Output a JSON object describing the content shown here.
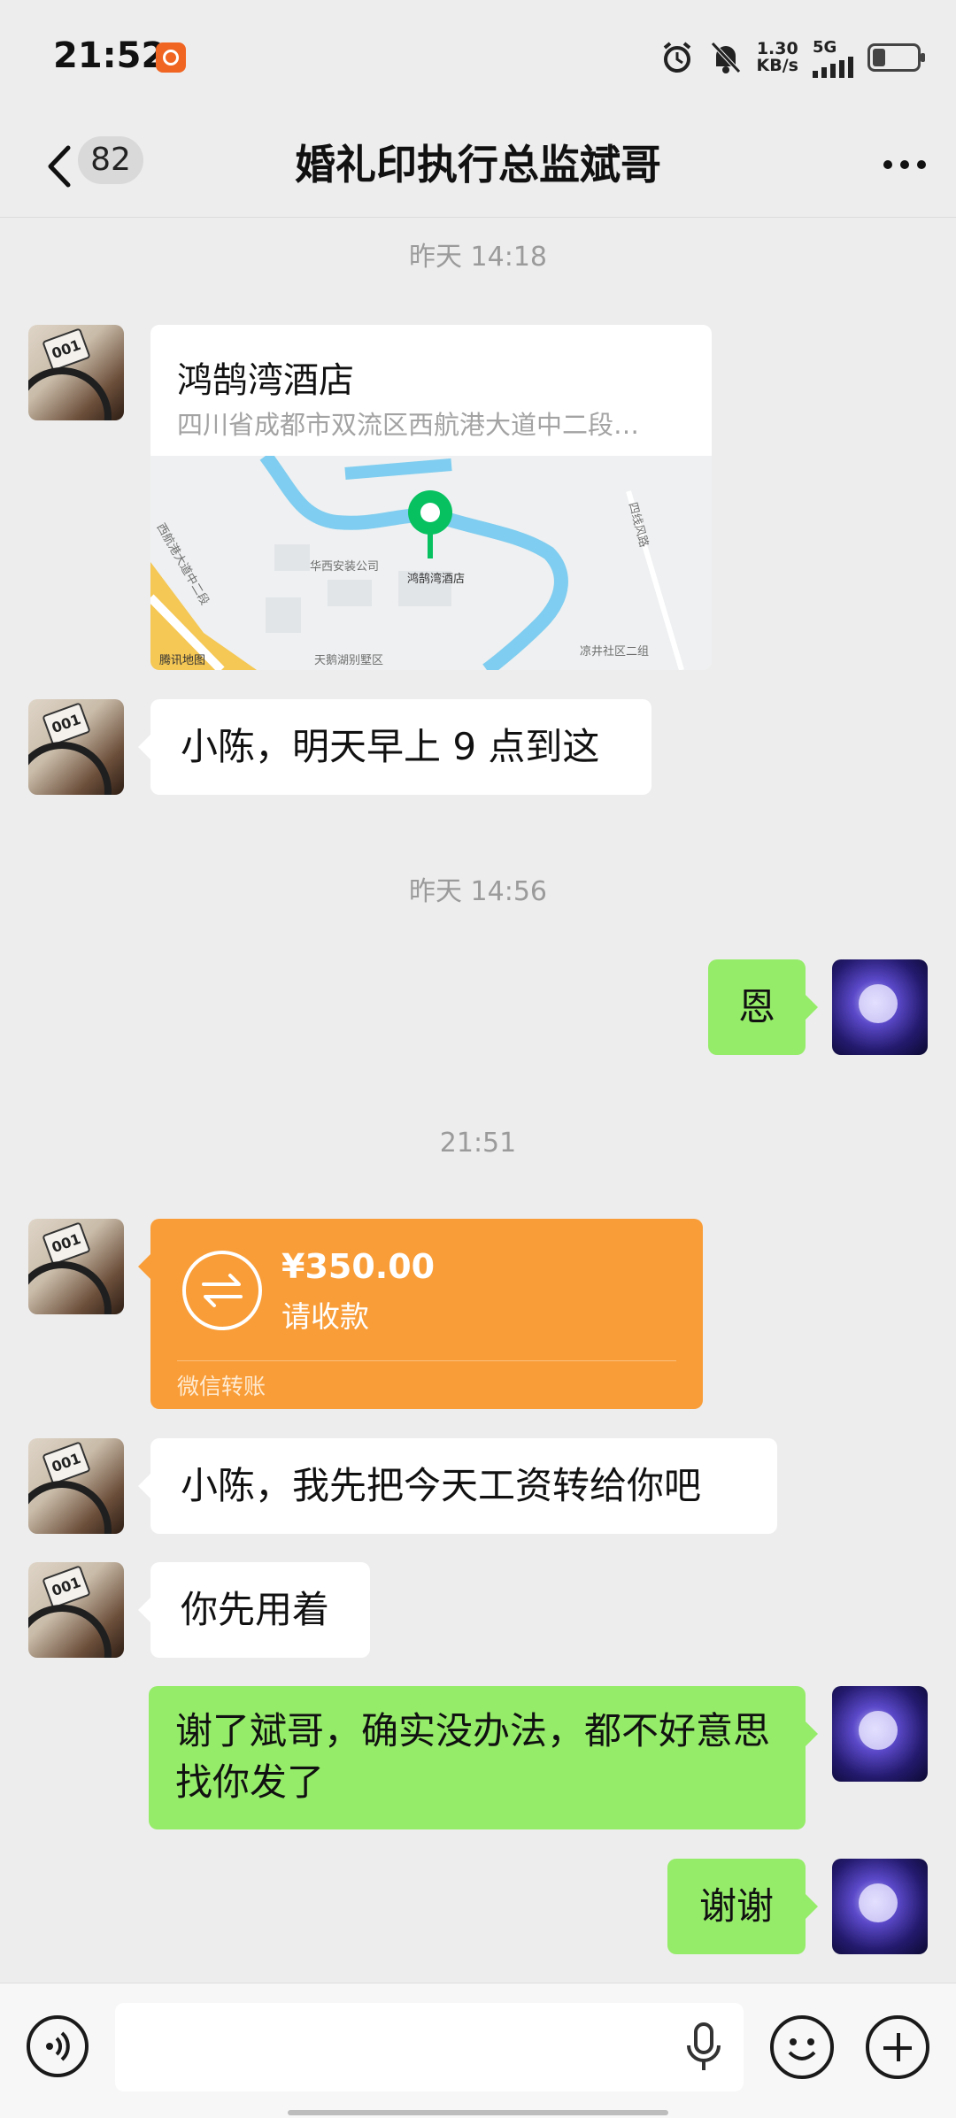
{
  "status_bar": {
    "time": "21:52",
    "net_speed_value": "1.30",
    "net_speed_unit": "KB/s",
    "network": "5G",
    "icons": [
      "alarm-icon",
      "mute-icon",
      "signal-icon",
      "battery-icon"
    ]
  },
  "header": {
    "unread_count": "82",
    "title": "婚礼印执行总监斌哥",
    "more_label": "···"
  },
  "messages": {
    "time1": "昨天 14:18",
    "location": {
      "name": "鸿鹄湾酒店",
      "address": "四川省成都市双流区西航港大道中二段…",
      "map_labels": {
        "hotel": "鸿鹄湾酒店",
        "company": "华西安装公司",
        "community": "凉井社区二组",
        "villa": "天鹅湖别墅区",
        "road_left": "西航港大道中二段",
        "road_right": "四线风路",
        "brand": "腾讯地图"
      }
    },
    "msg1": "小陈，明天早上 9 点到这",
    "time2": "昨天 14:56",
    "msg2": "恩",
    "time3": "21:51",
    "transfer": {
      "amount": "¥350.00",
      "status": "请收款",
      "footer": "微信转账"
    },
    "msg3": "小陈，我先把今天工资转给你吧",
    "msg4": "你先用着",
    "msg5": "谢了斌哥，确实没办法，都不好意思找你发了",
    "msg6": "谢谢"
  },
  "colors": {
    "outgoing_bubble": "#95ec69",
    "transfer_card": "#f99d38",
    "background": "#ededed"
  },
  "input_bar": {
    "placeholder": ""
  }
}
